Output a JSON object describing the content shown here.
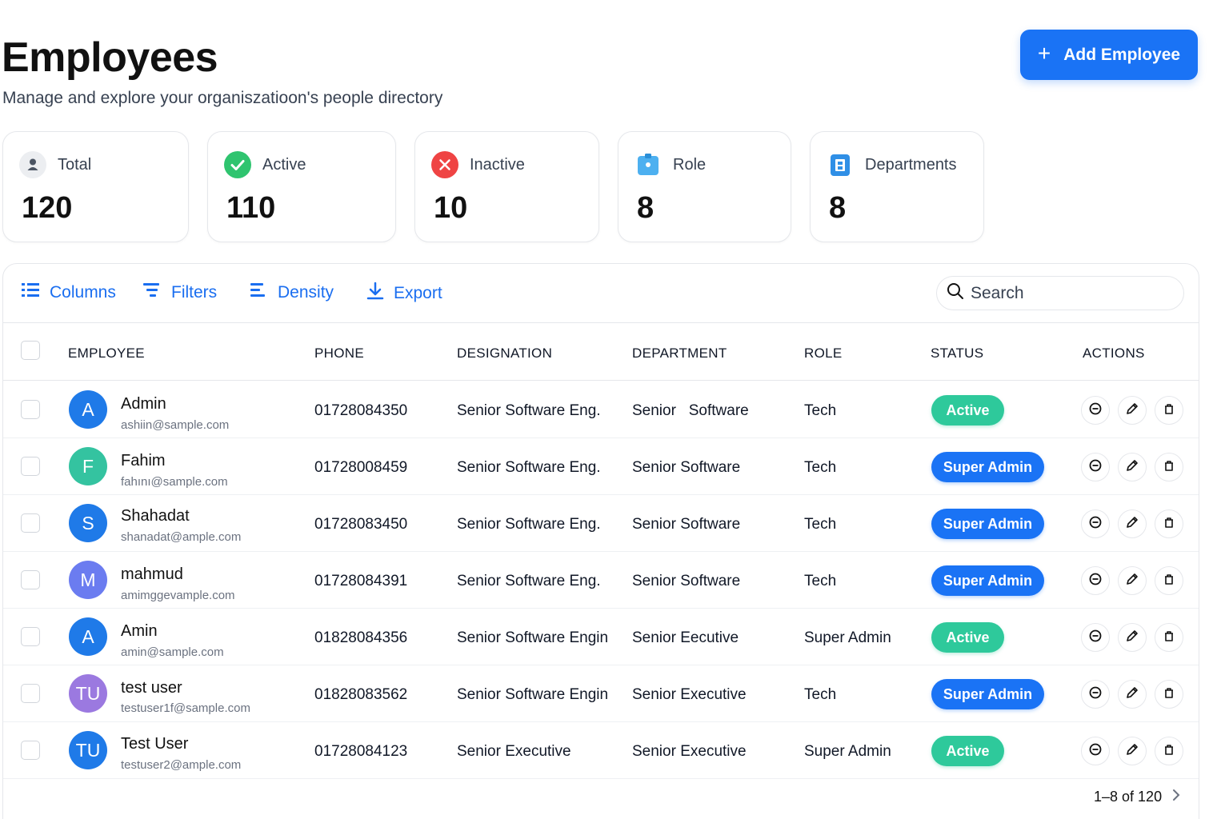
{
  "page": {
    "title": "Employees",
    "subtitle": "Manage and explore your organiszatioon's people directory",
    "add_button_label": "Add Employee"
  },
  "stats": [
    {
      "label": "Total",
      "value": "120",
      "icon": "user-icon"
    },
    {
      "label": "Active",
      "value": "110",
      "icon": "check-circle-icon"
    },
    {
      "label": "Inactive",
      "value": "10",
      "icon": "x-circle-icon"
    },
    {
      "label": "Role",
      "value": "8",
      "icon": "id-badge-icon"
    },
    {
      "label": "Departments",
      "value": "8",
      "icon": "building-icon"
    }
  ],
  "toolbar": {
    "columns_label": "Columns",
    "filters_label": "Filters",
    "density_label": "Density",
    "export_label": "Export",
    "search_placeholder": "Search"
  },
  "table": {
    "headers": [
      "EMPLOYEE",
      "PHONE",
      "DESIGNATION",
      "DEPARTMENT",
      "ROLE",
      "STATUS",
      "ACTIONS"
    ],
    "rows": [
      {
        "initial": "A",
        "name": "Admin",
        "email": "ashiin@sample.com",
        "phone": "01728084350",
        "designation": "Senior Software Eng.",
        "department": "Senior   Software",
        "role": "Tech",
        "status": "Active"
      },
      {
        "initial": "F",
        "name": "Fahim",
        "email": "fahını@sample.com",
        "phone": "01728008459",
        "designation": "Senior Software Eng.",
        "department": "Senior Software",
        "role": "Tech",
        "status": "Super Admin"
      },
      {
        "initial": "S",
        "name": "Shahadat",
        "email": "shanadat@ample.com",
        "phone": "01728083450",
        "designation": "Senior Software Eng.",
        "department": "Senior Software",
        "role": "Tech",
        "status": "Super Admin"
      },
      {
        "initial": "M",
        "name": "mahmud",
        "email": "amimggevample.com",
        "phone": "01728084391",
        "designation": "Senior Software Eng.",
        "department": "Senior Software",
        "role": "Tech",
        "status": "Super Admin"
      },
      {
        "initial": "A",
        "name": "Amin",
        "email": "amin@sample.com",
        "phone": "01828084356",
        "designation": "Senior Software Engin",
        "department": "Senior Eecutive",
        "role": "Super Admin",
        "status": "Active"
      },
      {
        "initial": "TU",
        "name": "test user",
        "email": "testuser1f@sample.com",
        "phone": "01828083562",
        "designation": "Senior Software Engin",
        "department": "Senior Executive",
        "role": "Tech",
        "status": "Super Admin"
      },
      {
        "initial": "TU",
        "name": "Test User",
        "email": "testuser2@ample.com",
        "phone": "01728084123",
        "designation": "Senior Executive",
        "department": "Senior Executive",
        "role": "Super Admin",
        "status": "Active"
      }
    ]
  },
  "pagination": {
    "range_text": "1–8 of 120"
  },
  "colors": {
    "primary": "#1a73f5",
    "active_badge": "#2ec99b",
    "avatar_blue": "#1f7ae8",
    "avatar_green": "#34c3a0",
    "avatar_purple": "#9b79e0",
    "avatar_indigo": "#6b7cf0"
  }
}
